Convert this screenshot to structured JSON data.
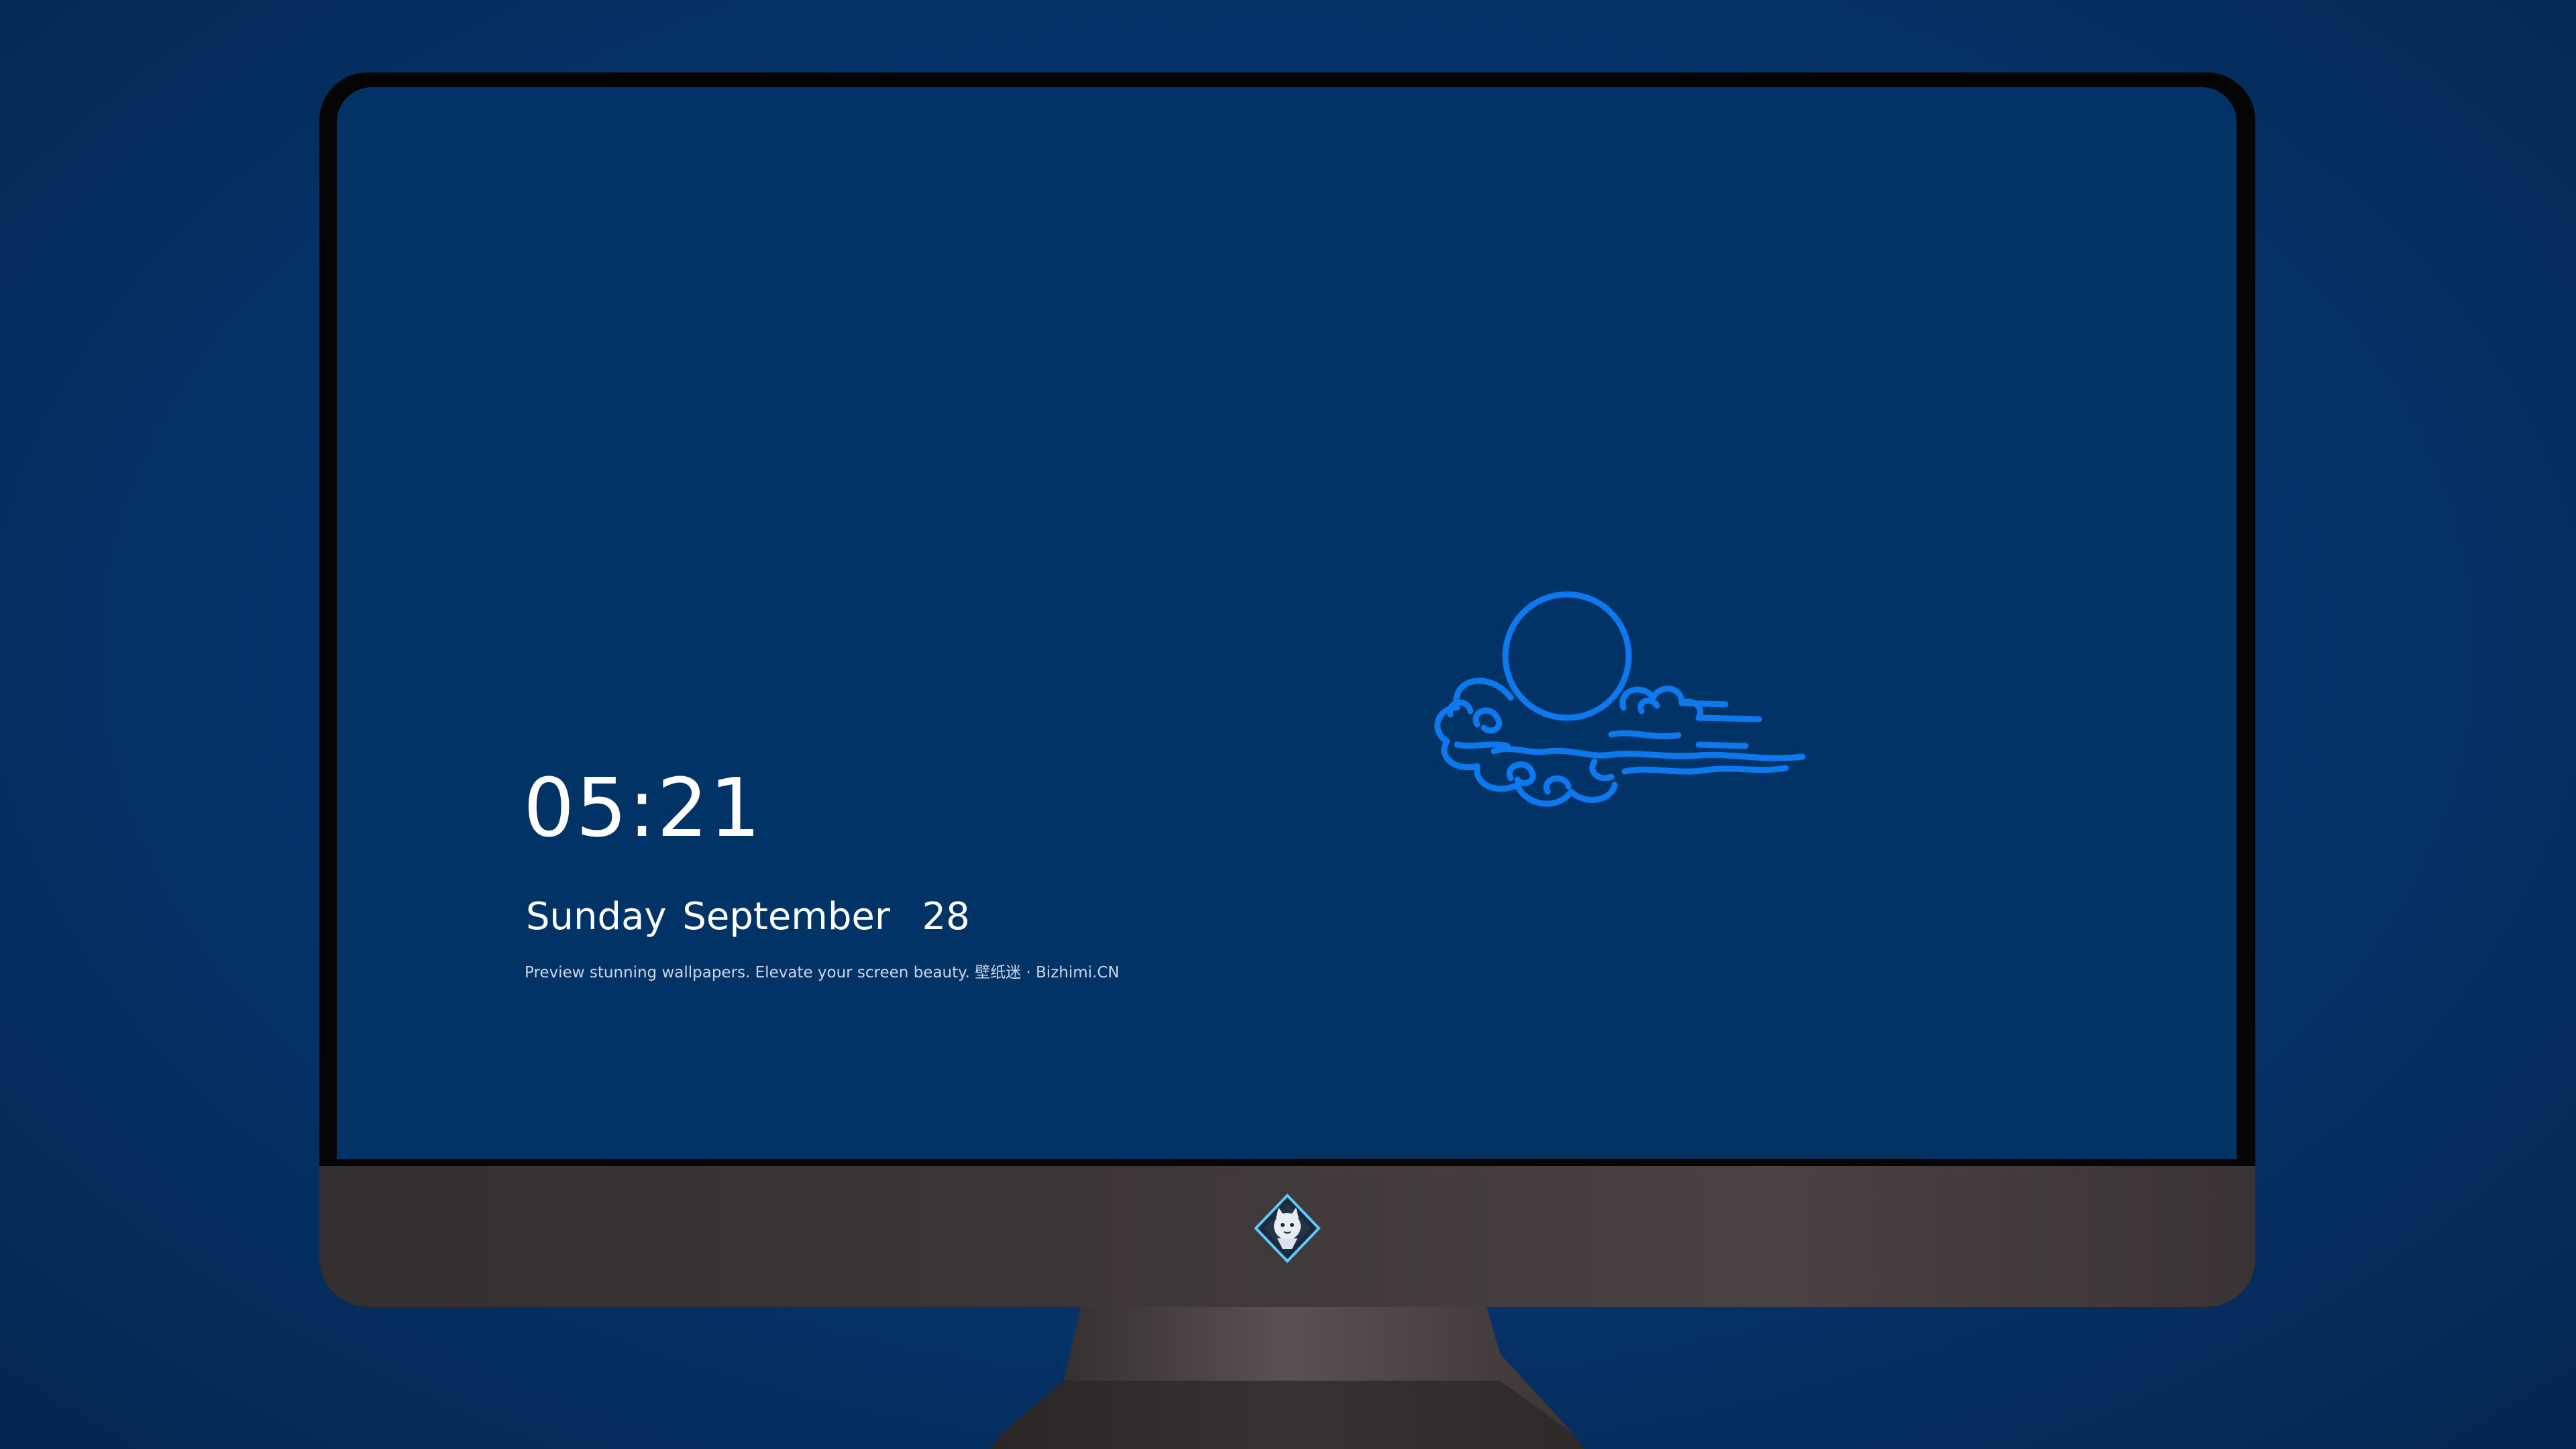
{
  "lockscreen": {
    "time": "05:21",
    "date": "Sunday September  28",
    "tagline": "Preview stunning wallpapers. Elevate your screen beauty. 壁纸迷 · Bizhimi.CN"
  },
  "wallpaper": {
    "emblem": "moon-over-clouds",
    "background_color": "#023366",
    "line_color": "#0e78ee"
  },
  "dock": {
    "apps": [
      {
        "name": "messages-icon",
        "color": "#36c24a"
      },
      {
        "name": "weather-icon",
        "color": "#1e7fe6"
      },
      {
        "name": "clock-icon",
        "color": "#111111"
      },
      {
        "name": "preview-icon",
        "color": "#e8e3c8"
      },
      {
        "name": "clips-icon",
        "color": "#54c3e8"
      },
      {
        "name": "notes-icon",
        "color": "#fbd63d"
      },
      {
        "name": "photo-grid-icon",
        "color": "#e9e9e9"
      },
      {
        "name": "music-icon",
        "color": "#d535d5"
      },
      {
        "name": "app-store-icon",
        "color": "#1c8ef2"
      },
      {
        "name": "camera-icon",
        "color": "#8a8a8a"
      }
    ]
  },
  "device": {
    "logo": "wolf-mascot-logo",
    "frame_color": "#050505",
    "chin_color": "#3d3637"
  }
}
